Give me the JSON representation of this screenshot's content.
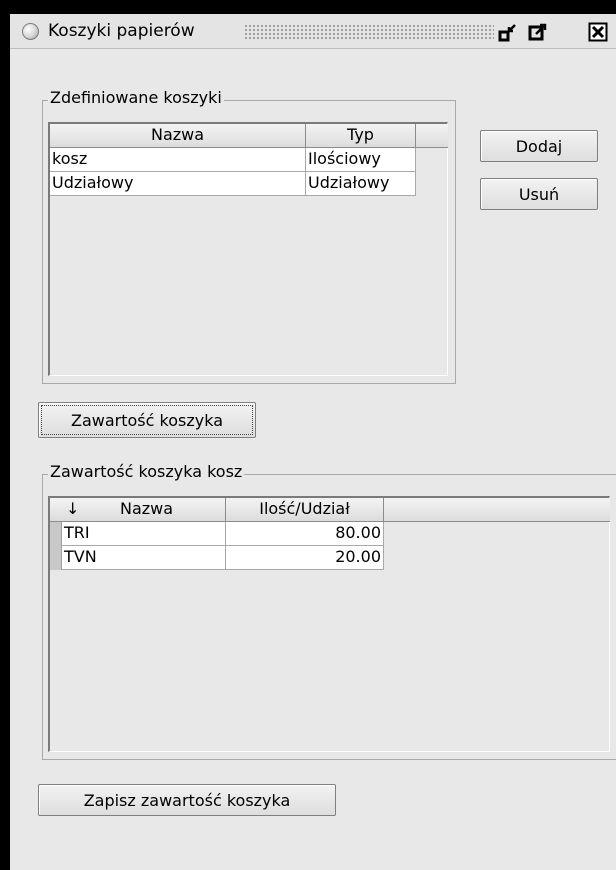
{
  "window": {
    "title": "Koszyki papierów"
  },
  "defined_baskets": {
    "legend": "Zdefiniowane koszyki",
    "columns": [
      "Nazwa",
      "Typ"
    ],
    "rows": [
      {
        "name": "kosz",
        "type": "Ilościowy"
      },
      {
        "name": "Udziałowy",
        "type": "Udziałowy"
      }
    ],
    "add_label": "Dodaj",
    "remove_label": "Usuń"
  },
  "show_contents_label": "Zawartość koszyka",
  "basket_contents": {
    "legend": "Zawartość koszyka kosz",
    "sort_indicator": "↓",
    "columns": [
      "Nazwa",
      "Ilość/Udział"
    ],
    "rows": [
      {
        "name": "TRI",
        "value": "80.00"
      },
      {
        "name": "TVN",
        "value": "20.00"
      }
    ]
  },
  "save_contents_label": "Zapisz zawartość koszyka",
  "icons": [
    "radio-circle-icon",
    "minimize-icon",
    "maximize-icon",
    "close-icon"
  ]
}
